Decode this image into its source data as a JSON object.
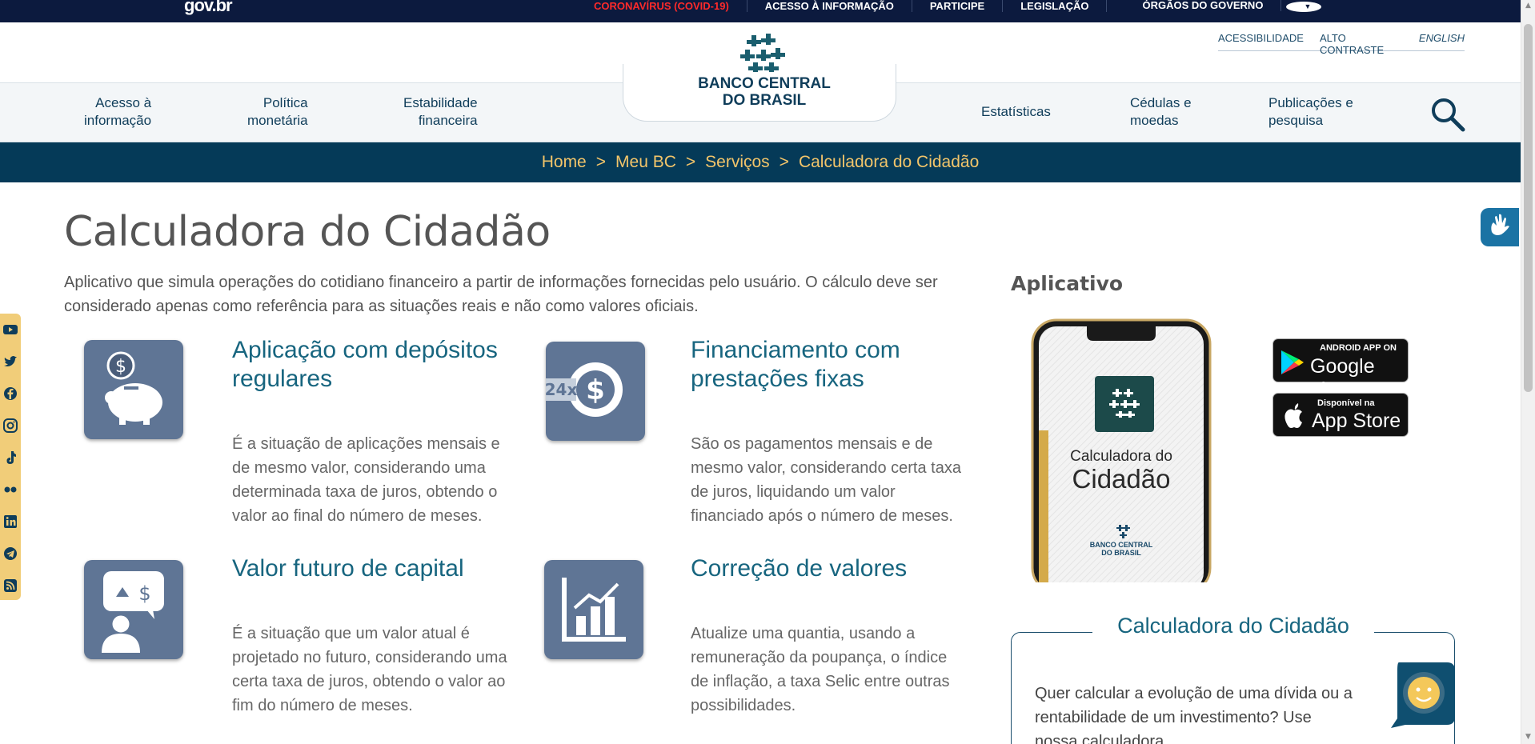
{
  "govbar": {
    "logo": "gov.br",
    "links": [
      {
        "label": "CORONAVÍRUS (COVID-19)"
      },
      {
        "label": "ACESSO À INFORMAÇÃO"
      },
      {
        "label": "PARTICIPE"
      },
      {
        "label": "LEGISLAÇÃO"
      },
      {
        "label": "ÓRGÃOS DO GOVERNO"
      }
    ]
  },
  "utility": {
    "accessibility": "ACESSIBILIDADE",
    "contrast": "ALTO CONTRASTE",
    "english": "ENGLISH"
  },
  "brand": {
    "line1": "BANCO CENTRAL",
    "line2": "DO BRASIL"
  },
  "nav": [
    {
      "line1": "Acesso à",
      "line2": "informação"
    },
    {
      "line1": "Política",
      "line2": "monetária"
    },
    {
      "line1": "Estabilidade",
      "line2": "financeira"
    },
    {
      "line1": "Estatísticas",
      "line2": ""
    },
    {
      "line1": "Cédulas e",
      "line2": "moedas"
    },
    {
      "line1": "Publicações e",
      "line2": "pesquisa"
    }
  ],
  "breadcrumb": {
    "items": [
      "Home",
      "Meu BC",
      "Serviços",
      "Calculadora do Cidadão"
    ],
    "separator": ">"
  },
  "page": {
    "title": "Calculadora do Cidadão",
    "intro": "Aplicativo que simula operações do cotidiano financeiro a partir de informações fornecidas pelo usuário. O cálculo deve ser considerado apenas como referência para as situações reais e não como valores oficiais."
  },
  "tiles": [
    {
      "title": "Aplicação com depósitos regulares",
      "desc": "É a situação de aplicações mensais e de mesmo valor, considerando uma determinada taxa de juros, obtendo o valor ao final do número de meses.",
      "icon": "piggy-bank-icon"
    },
    {
      "title": "Financiamento com prestações fixas",
      "desc": "São os pagamentos mensais e de mesmo valor, considerando certa taxa de juros, liquidando um valor financiado após o número de meses.",
      "icon": "installments-24x-icon",
      "icon_text": "24x"
    },
    {
      "title": "Valor futuro de capital",
      "desc": "É a situação que um valor atual é projetado no futuro, considerando uma certa taxa de juros, obtendo o valor ao fim do número de meses.",
      "icon": "person-thinking-money-icon"
    },
    {
      "title": "Correção de valores",
      "desc": "Atualize uma quantia, usando a remuneração da poupança, o índice de inflação, a taxa Selic entre outras possibilidades.",
      "icon": "bar-chart-growth-icon"
    }
  ],
  "app": {
    "heading": "Aplicativo",
    "phone_line1": "Calculadora do",
    "phone_line2": "Cidadão",
    "phone_brand1": "BANCO CENTRAL",
    "phone_brand2": "DO BRASIL",
    "google_small": "ANDROID APP ON",
    "google_large": "Google play",
    "apple_small": "Disponível na",
    "apple_large": "App Store"
  },
  "calc_box": {
    "title": "Calculadora do Cidadão",
    "text": "Quer calcular a evolução de uma dívida ou a rentabilidade de um investimento? Use nossa calculadora."
  },
  "social_icons": [
    "youtube-icon",
    "twitter-icon",
    "facebook-icon",
    "instagram-icon",
    "tiktok-icon",
    "flickr-icon",
    "linkedin-icon",
    "telegram-icon",
    "rss-icon"
  ],
  "colors": {
    "govbar": "#0c1a3e",
    "breadcrumb_bg": "#053a58",
    "breadcrumb_text": "#f3c56a",
    "accent": "#17657f",
    "tile_icon": "#5f7595",
    "social_bar": "#f1cd79"
  }
}
